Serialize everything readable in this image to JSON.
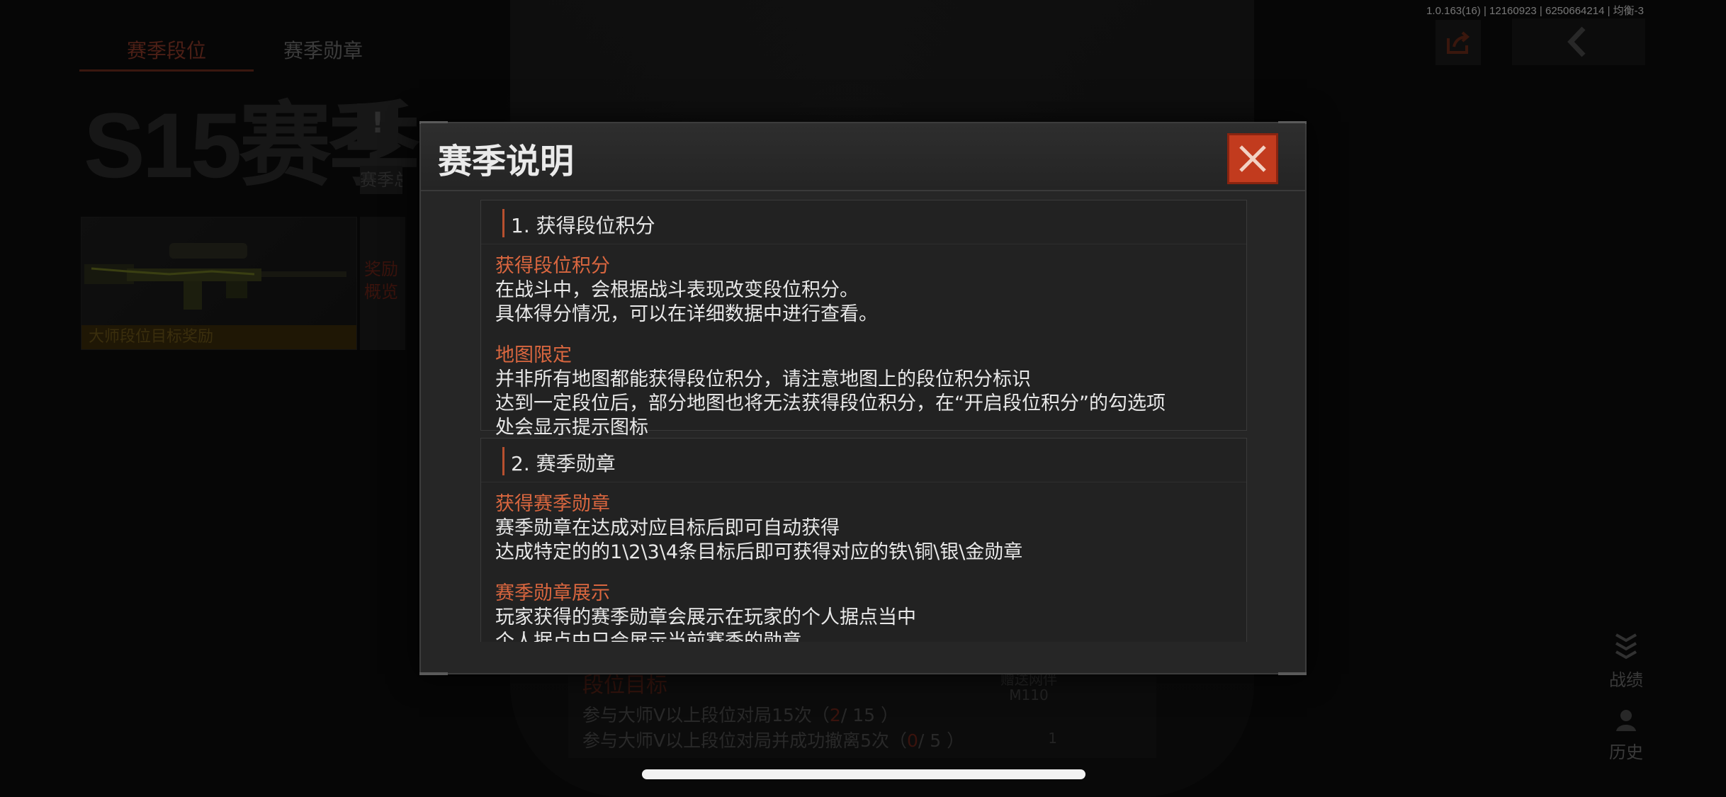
{
  "version": "1.0.163(16) | 12160923 | 6250664214 | 均衡-3",
  "tabs": {
    "season_rank": "赛季段位",
    "season_medal": "赛季勋章"
  },
  "season": {
    "title": "S15赛季",
    "info_badge": "!",
    "sub_label": "赛季总"
  },
  "reward": {
    "caption": "大师段位目标奖励",
    "side_label": "奖励概览"
  },
  "side_nav": {
    "stats": "战绩",
    "history": "历史"
  },
  "goals": {
    "title": "段位目标",
    "line1_prefix": "参与大师V以上段位对局15次（",
    "line1_progress": "2",
    "line1_suffix": "/ 15 ）",
    "line2_prefix": "参与大师V以上段位对局并成功撤离5次（",
    "line2_progress": "0",
    "line2_suffix": "/ 5 ）",
    "right_label_1": "赠送网伴",
    "right_label_2": "M110",
    "right_count": "1"
  },
  "modal": {
    "title": "赛季说明",
    "sections": [
      {
        "title": "1. 获得段位积分",
        "blocks": [
          {
            "subtitle": "获得段位积分",
            "lines": [
              "在战斗中，会根据战斗表现改变段位积分。",
              "具体得分情况，可以在详细数据中进行查看。"
            ]
          },
          {
            "subtitle": "地图限定",
            "lines": [
              "并非所有地图都能获得段位积分，请注意地图上的段位积分标识",
              "达到一定段位后，部分地图也将无法获得段位积分，在“开启段位积分”的勾选项",
              "处会显示提示图标"
            ]
          }
        ]
      },
      {
        "title": "2. 赛季勋章",
        "blocks": [
          {
            "subtitle": "获得赛季勋章",
            "lines": [
              "赛季勋章在达成对应目标后即可自动获得",
              "达成特定的的1\\2\\3\\4条目标后即可获得对应的铁\\铜\\银\\金勋章"
            ]
          },
          {
            "subtitle": "赛季勋章展示",
            "lines": [
              "玩家获得的赛季勋章会展示在玩家的个人据点当中",
              "个人据点中只会展示当前赛季的勋章"
            ]
          }
        ]
      }
    ]
  },
  "colors": {
    "accent_orange": "#d9663f",
    "close_red": "#c23b1e",
    "modal_bg": "#262626"
  },
  "icons": {
    "close": "close-icon",
    "share": "share-icon",
    "back": "chevron-left-icon"
  }
}
